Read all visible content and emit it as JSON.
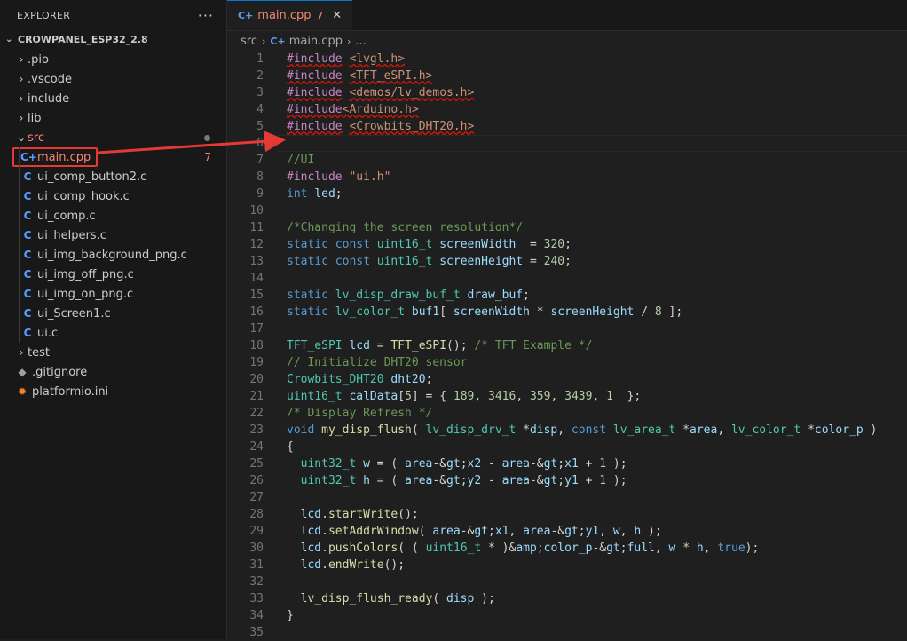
{
  "sidebar": {
    "title": "EXPLORER",
    "more": "···",
    "root": "CROWPANEL_ESP32_2.8",
    "items": [
      {
        "label": ".pio"
      },
      {
        "label": ".vscode"
      },
      {
        "label": "include"
      },
      {
        "label": "lib"
      },
      {
        "label": "src"
      },
      {
        "label": "main.cpp",
        "badge": "7"
      },
      {
        "label": "ui_comp_button2.c"
      },
      {
        "label": "ui_comp_hook.c"
      },
      {
        "label": "ui_comp.c"
      },
      {
        "label": "ui_helpers.c"
      },
      {
        "label": "ui_img_background_png.c"
      },
      {
        "label": "ui_img_off_png.c"
      },
      {
        "label": "ui_img_on_png.c"
      },
      {
        "label": "ui_Screen1.c"
      },
      {
        "label": "ui.c"
      },
      {
        "label": "test"
      },
      {
        "label": ".gitignore"
      },
      {
        "label": "platformio.ini"
      }
    ]
  },
  "tab": {
    "icon": "C+",
    "name": "main.cpp",
    "count": "7",
    "close": "✕"
  },
  "breadcrumb": {
    "folder": "src",
    "file": "main.cpp",
    "more": "..."
  },
  "code": [
    "#include <lvgl.h>",
    "#include <TFT_eSPI.h>",
    "#include <demos/lv_demos.h>",
    "#include<Arduino.h>",
    "#include <Crowbits_DHT20.h>",
    "",
    "//UI",
    "#include \"ui.h\"",
    "int led;",
    "",
    "/*Changing the screen resolution*/",
    "static const uint16_t screenWidth  = 320;",
    "static const uint16_t screenHeight = 240;",
    "",
    "static lv_disp_draw_buf_t draw_buf;",
    "static lv_color_t buf1[ screenWidth * screenHeight / 8 ];",
    "",
    "TFT_eSPI lcd = TFT_eSPI(); /* TFT Example */",
    "// Initialize DHT20 sensor",
    "Crowbits_DHT20 dht20;",
    "uint16_t calData[5] = { 189, 3416, 359, 3439, 1  };",
    "/* Display Refresh */",
    "void my_disp_flush( lv_disp_drv_t *disp, const lv_area_t *area, lv_color_t *color_p )",
    "{",
    "  uint32_t w = ( area->x2 - area->x1 + 1 );",
    "  uint32_t h = ( area->y2 - area->y1 + 1 );",
    "",
    "  lcd.startWrite();",
    "  lcd.setAddrWindow( area->x1, area->y1, w, h );",
    "  lcd.pushColors( ( uint16_t * )&color_p->full, w * h, true);",
    "  lcd.endWrite();",
    "",
    "  lv_disp_flush_ready( disp );",
    "}",
    ""
  ],
  "colors": {
    "accent": "#0078d4",
    "error": "#f48771",
    "annotation": "#e53935"
  }
}
